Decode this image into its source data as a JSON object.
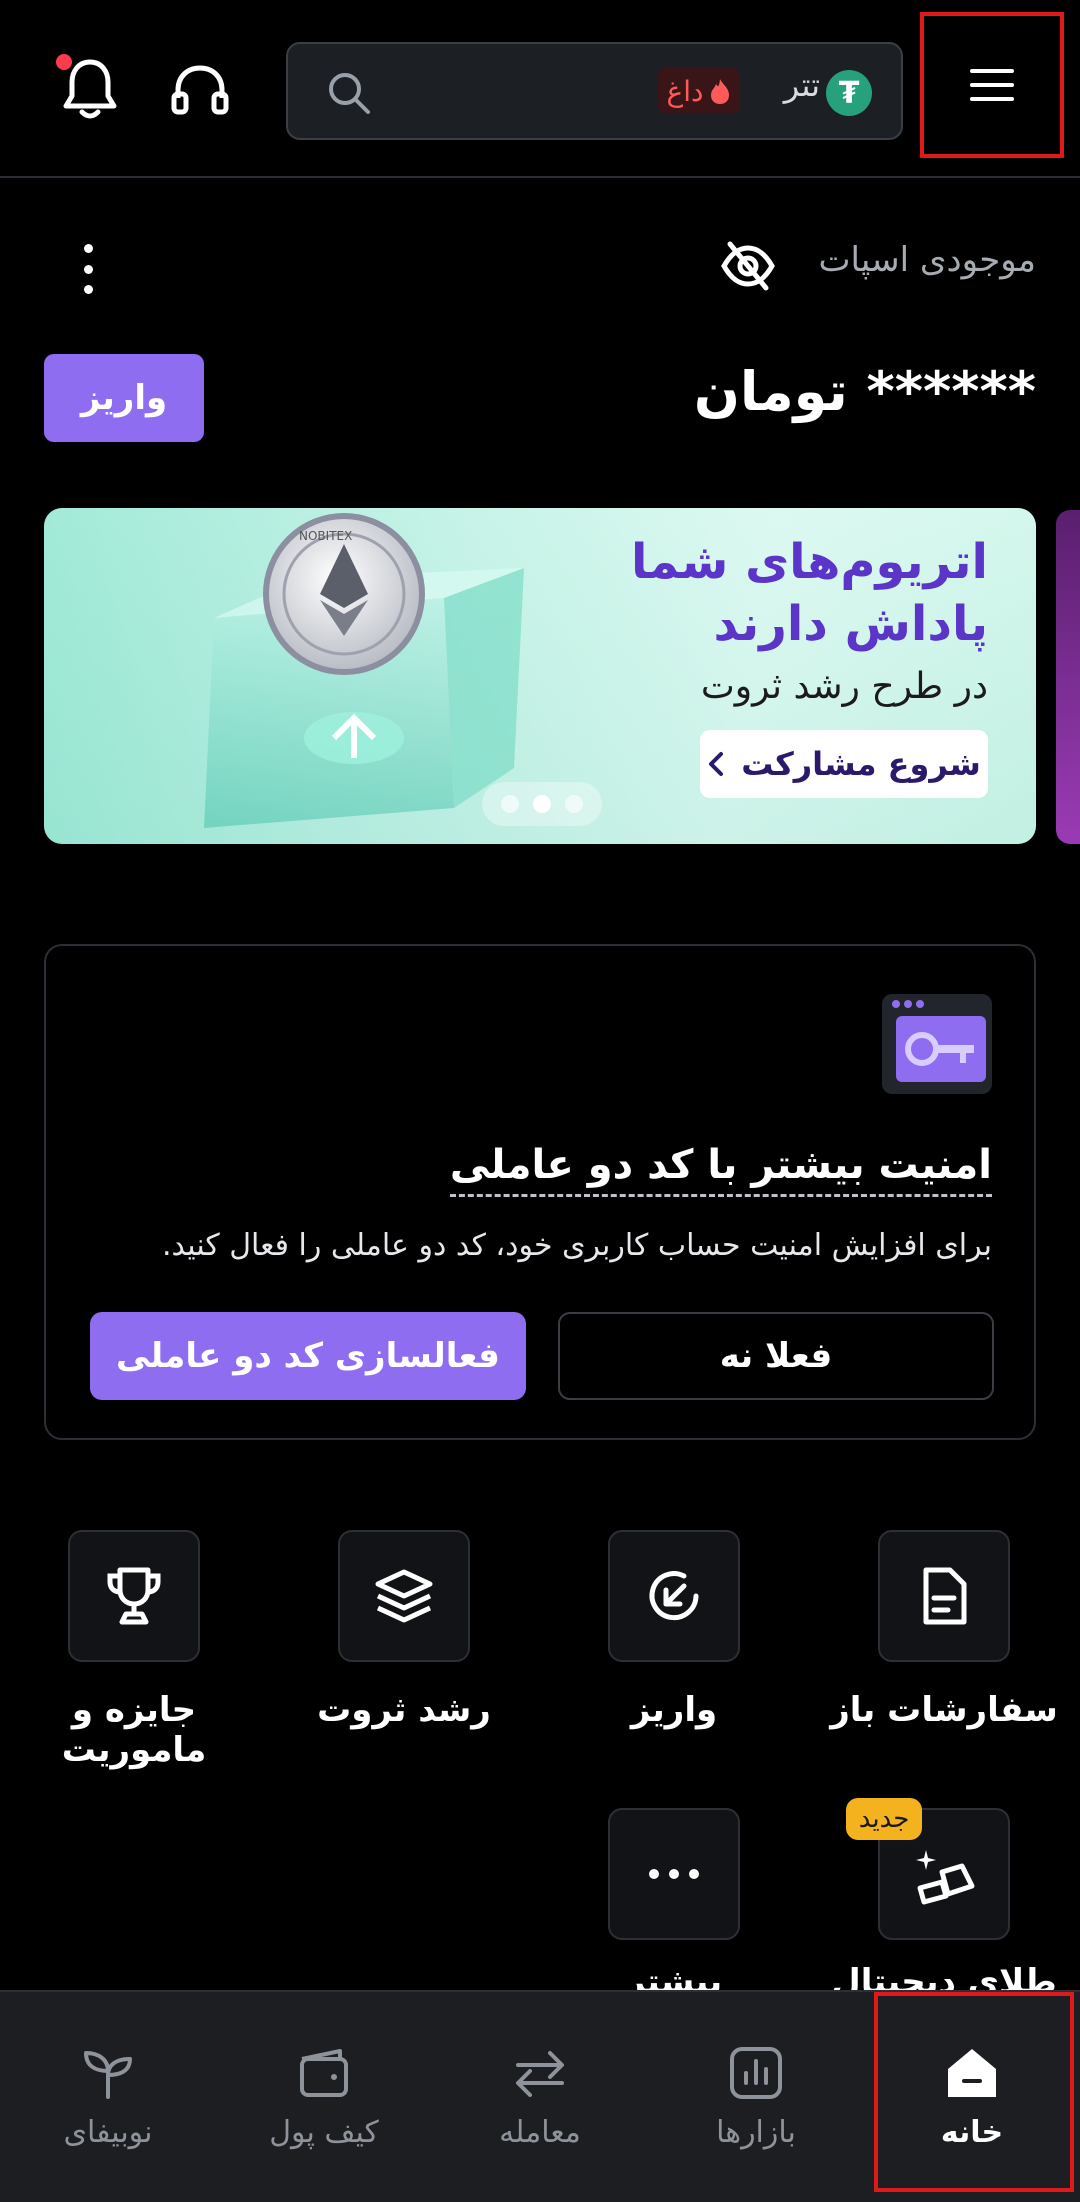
{
  "header": {
    "search": {
      "coin_name": "تتر",
      "coin_symbol": "₮",
      "hot_label": "داغ"
    },
    "icons": [
      "menu-icon",
      "search-icon",
      "headset-icon",
      "bell-icon"
    ]
  },
  "balance": {
    "label": "موجودی اسپات",
    "value": "****** تومان",
    "deposit_label": "واریز"
  },
  "banner": {
    "title_line1": "اتریوم‌های شما",
    "title_line2": "پاداش دارند",
    "subtitle": "در طرح رشد ثروت",
    "cta_label": "شروع مشارکت",
    "coin_text": "NOBITEX"
  },
  "twofa": {
    "title": "امنیت بیشتر با کد دو عاملی",
    "description": "برای افزایش امنیت حساب کاربری خود، کد دو عاملی را فعال کنید.",
    "later_label": "فعلا نه",
    "enable_label": "فعالسازی کد دو عاملی"
  },
  "quick_actions": {
    "row1": [
      {
        "label": "سفارشات باز",
        "icon": "document-icon"
      },
      {
        "label": "واریز",
        "icon": "deposit-icon"
      },
      {
        "label": "رشد ثروت",
        "icon": "stack-icon"
      },
      {
        "label": "جایزه و ماموریت",
        "icon": "trophy-icon"
      }
    ],
    "row2": [
      {
        "label": "طلای دیجیتال",
        "icon": "gold-icon",
        "badge": "جدید"
      },
      {
        "label": "بیشتر",
        "icon": "more-icon"
      }
    ]
  },
  "bottom_nav": [
    {
      "label": "خانه",
      "icon": "home-icon",
      "active": true
    },
    {
      "label": "بازارها",
      "icon": "chart-icon"
    },
    {
      "label": "معامله",
      "icon": "swap-icon"
    },
    {
      "label": "کیف پول",
      "icon": "wallet-icon"
    },
    {
      "label": "نوبیفای",
      "icon": "sprout-icon"
    }
  ],
  "colors": {
    "accent": "#8e6df0",
    "highlight": "#e01a1a",
    "badge": "#f5b21f"
  }
}
